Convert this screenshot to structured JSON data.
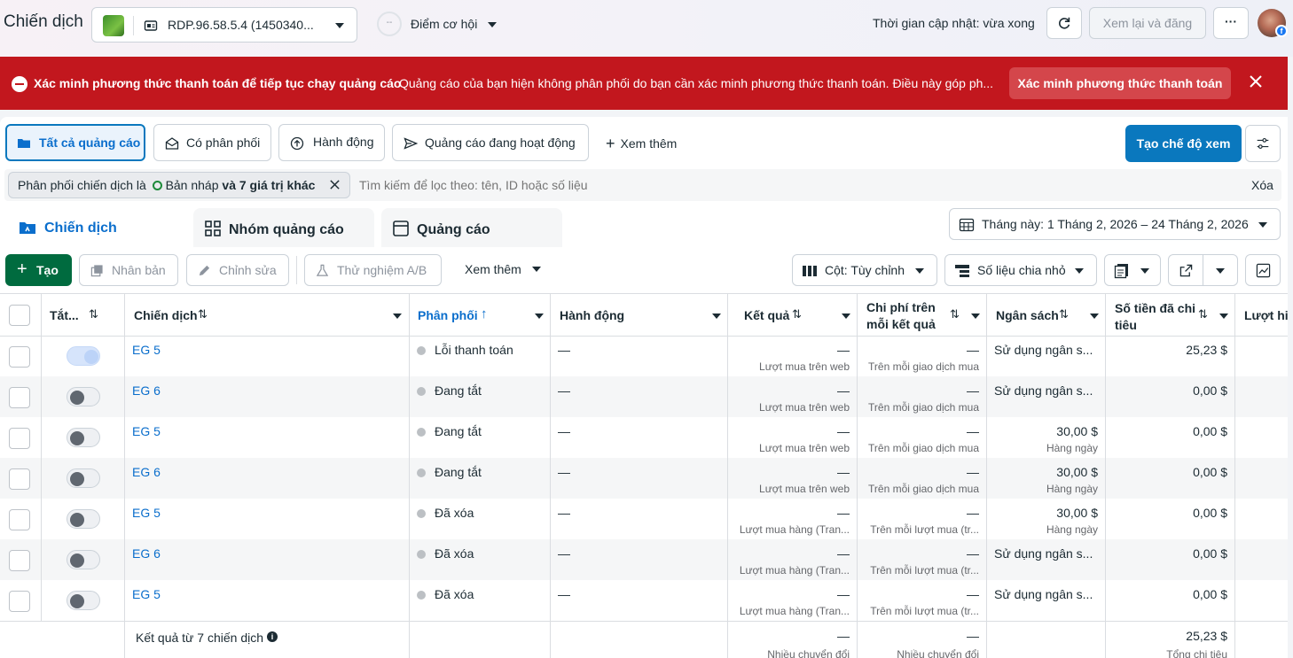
{
  "header": {
    "title": "Chiến dịch",
    "account_name": "RDP.96.58.5.4 (1450340...",
    "opportunity_score": "--",
    "opportunity_label": "Điểm cơ hội",
    "updated_text": "Thời gian cập nhật: vừa xong",
    "review_publish_label": "Xem lại và đăng",
    "more_label": "···"
  },
  "alert": {
    "title": "Xác minh phương thức thanh toán để tiếp tục chạy quảng cáo",
    "message": "Quảng cáo của bạn hiện không phân phối do bạn cần xác minh phương thức thanh toán. Điều này góp ph...",
    "action_label": "Xác minh phương thức thanh toán"
  },
  "view_tabs": [
    {
      "label": "Tất cả quảng cáo",
      "active": true
    },
    {
      "label": "Có phân phối"
    },
    {
      "label": "Hành động"
    },
    {
      "label": "Quảng cáo đang hoạt động"
    }
  ],
  "view_more_label": "Xem thêm",
  "create_view_label": "Tạo chế độ xem",
  "filter": {
    "chip_prefix": "Phân phối chiến dịch là",
    "chip_value": "Bản nháp",
    "chip_suffix": "và 7 giá trị khác",
    "search_placeholder": "Tìm kiếm để lọc theo: tên, ID hoặc số liệu",
    "clear_label": "Xóa"
  },
  "level_tabs": [
    {
      "label": "Chiến dịch",
      "active": true
    },
    {
      "label": "Nhóm quảng cáo"
    },
    {
      "label": "Quảng cáo"
    }
  ],
  "date_range": "Tháng này: 1 Tháng 2, 2026 – 24 Tháng 2, 2026",
  "toolbar": {
    "create_label": "Tạo",
    "duplicate_label": "Nhân bản",
    "edit_label": "Chỉnh sửa",
    "ab_test_label": "Thử nghiệm A/B",
    "more_label": "Xem thêm",
    "columns_label": "Cột: Tùy chỉnh",
    "breakdown_label": "Số liệu chia nhỏ"
  },
  "columns": {
    "toggle": "Tắt...",
    "campaign": "Chiến dịch",
    "delivery": "Phân phối",
    "actions": "Hành động",
    "results": "Kết quả",
    "cost_per_result_1": "Chi phí trên",
    "cost_per_result_2": "mỗi kết quả",
    "budget": "Ngân sách",
    "amount_spent_1": "Số tiền đã chi",
    "amount_spent_2": "tiêu",
    "reach": "Lượt hi"
  },
  "rows": [
    {
      "on": true,
      "name": "EG 5",
      "delivery": "Lỗi thanh toán",
      "action": "—",
      "result": "—",
      "result_sub": "Lượt mua trên web",
      "cpr": "—",
      "cpr_sub": "Trên mỗi giao dịch mua",
      "budget": "Sử dụng ngân s...",
      "budget_sub": "",
      "spent": "25,23 $"
    },
    {
      "on": false,
      "name": "EG 6",
      "delivery": "Đang tắt",
      "action": "—",
      "result": "—",
      "result_sub": "Lượt mua trên web",
      "cpr": "—",
      "cpr_sub": "Trên mỗi giao dịch mua",
      "budget": "Sử dụng ngân s...",
      "budget_sub": "",
      "spent": "0,00 $"
    },
    {
      "on": false,
      "name": "EG 5",
      "delivery": "Đang tắt",
      "action": "—",
      "result": "—",
      "result_sub": "Lượt mua trên web",
      "cpr": "—",
      "cpr_sub": "Trên mỗi giao dịch mua",
      "budget": "30,00 $",
      "budget_sub": "Hàng ngày",
      "spent": "0,00 $"
    },
    {
      "on": false,
      "name": "EG 6",
      "delivery": "Đang tắt",
      "action": "—",
      "result": "—",
      "result_sub": "Lượt mua trên web",
      "cpr": "—",
      "cpr_sub": "Trên mỗi giao dịch mua",
      "budget": "30,00 $",
      "budget_sub": "Hàng ngày",
      "spent": "0,00 $"
    },
    {
      "on": false,
      "name": "EG 5",
      "delivery": "Đã xóa",
      "action": "—",
      "result": "—",
      "result_sub": "Lượt mua hàng (Tran...",
      "cpr": "—",
      "cpr_sub": "Trên mỗi lượt mua (tr...",
      "budget": "30,00 $",
      "budget_sub": "Hàng ngày",
      "spent": "0,00 $"
    },
    {
      "on": false,
      "name": "EG 6",
      "delivery": "Đã xóa",
      "action": "—",
      "result": "—",
      "result_sub": "Lượt mua hàng (Tran...",
      "cpr": "—",
      "cpr_sub": "Trên mỗi lượt mua (tr...",
      "budget": "Sử dụng ngân s...",
      "budget_sub": "",
      "spent": "0,00 $"
    },
    {
      "on": false,
      "name": "EG 5",
      "delivery": "Đã xóa",
      "action": "—",
      "result": "—",
      "result_sub": "Lượt mua hàng (Tran...",
      "cpr": "—",
      "cpr_sub": "Trên mỗi lượt mua (tr...",
      "budget": "Sử dụng ngân s...",
      "budget_sub": "",
      "spent": "0,00 $"
    }
  ],
  "summary": {
    "label": "Kết quả từ 7 chiến dịch",
    "result": "—",
    "result_sub": "Nhiều chuyển đổi",
    "cpr": "—",
    "cpr_sub": "Nhiều chuyển đổi",
    "spent": "25,23 $",
    "spent_sub": "Tổng chi tiêu"
  },
  "colors": {
    "accent": "#0a6ecc",
    "primary_button": "#0a78be",
    "alert_bg": "#c2171e",
    "create_button": "#006b3f"
  }
}
